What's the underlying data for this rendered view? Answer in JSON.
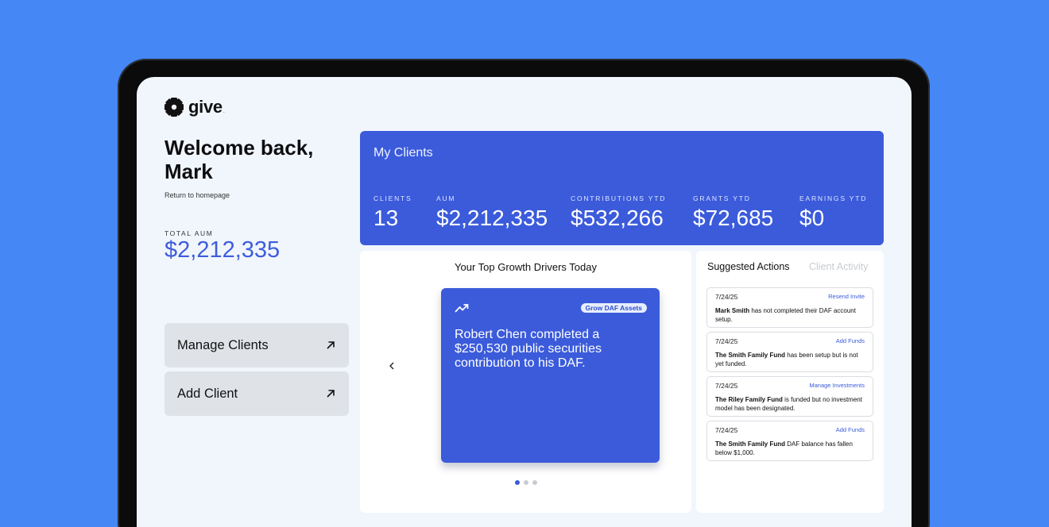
{
  "brand": {
    "name": "give",
    "mark": "."
  },
  "welcome": {
    "greeting": "Welcome back, Mark",
    "return_link": "Return to homepage"
  },
  "total_aum": {
    "label": "TOTAL AUM",
    "value": "$2,212,335"
  },
  "nav": {
    "manage_clients": "Manage Clients",
    "add_client": "Add Client"
  },
  "clients_card": {
    "title": "My Clients",
    "stats": [
      {
        "label": "CLIENTS",
        "value": "13"
      },
      {
        "label": "AUM",
        "value": "$2,212,335"
      },
      {
        "label": "CONTRIBUTIONS YTD",
        "value": "$532,266"
      },
      {
        "label": "GRANTS YTD",
        "value": "$72,685"
      },
      {
        "label": "EARNINGS YTD",
        "value": "$0"
      }
    ]
  },
  "growth": {
    "title": "Your Top Growth Drivers Today",
    "card": {
      "tag": "Grow DAF Assets",
      "text": "Robert Chen completed a $250,530 public securities contribution to his DAF.",
      "icon": "trending-up-icon"
    },
    "pagination": {
      "total": 3,
      "active": 1
    }
  },
  "actions": {
    "tabs": {
      "active": "Suggested Actions",
      "inactive": "Client Activity"
    },
    "items": [
      {
        "date": "7/24/25",
        "link": "Resend Invite",
        "bold": "Mark Smith",
        "text": " has not completed their DAF account setup."
      },
      {
        "date": "7/24/25",
        "link": "Add Funds",
        "bold": "The Smith Family Fund",
        "text": " has been setup but is not yet funded."
      },
      {
        "date": "7/24/25",
        "link": "Manage Investments",
        "bold": "The Riley Family Fund",
        "text": " is funded but no investment model has been designated."
      },
      {
        "date": "7/24/25",
        "link": "Add Funds",
        "bold": "The Smith Family Fund",
        "text": " DAF balance has fallen below $1,000."
      }
    ]
  },
  "colors": {
    "background": "#4487f5",
    "accent": "#3b5bdb",
    "screen": "#f1f6fd"
  }
}
